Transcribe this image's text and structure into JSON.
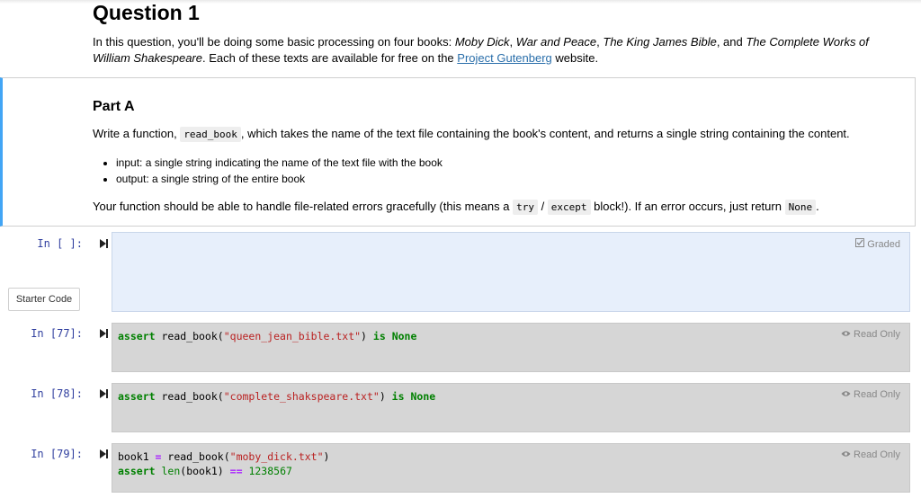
{
  "question": {
    "title": "Question 1",
    "intro": {
      "t1": "In this question, you'll be doing some basic processing on four books: ",
      "book1": "Moby Dick",
      "sep1": ", ",
      "book2": "War and Peace",
      "sep2": ", ",
      "book3": "The King James Bible",
      "sep3": ", and ",
      "book4": "The Complete Works of William Shakespeare",
      "t2": ". Each of these texts are available for free on the ",
      "link": "Project Gutenberg",
      "t3": " website."
    }
  },
  "partA": {
    "title": "Part A",
    "p1_a": "Write a function, ",
    "p1_code": "read_book",
    "p1_b": ", which takes the name of the text file containing the book's content, and returns a single string containing the content.",
    "bullets": [
      "input: a single string indicating the name of the text file with the book",
      "output: a single string of the entire book"
    ],
    "p2_a": "Your function should be able to handle file-related errors gracefully (this means a ",
    "p2_code1": "try",
    "p2_slash": " / ",
    "p2_code2": "except",
    "p2_b": " block!). If an error occurs, just return ",
    "p2_code3": "None",
    "p2_c": "."
  },
  "cells": {
    "c0": {
      "prompt": "In [ ]:",
      "badge": "Graded",
      "starter": "Starter Code"
    },
    "c1": {
      "prompt": "In [77]:",
      "badge": "Read Only",
      "t1": "assert",
      "t2": " read_book(",
      "t3": "\"queen_jean_bible.txt\"",
      "t4": ") ",
      "t5": "is",
      "t6": " ",
      "t7": "None"
    },
    "c2": {
      "prompt": "In [78]:",
      "badge": "Read Only",
      "t1": "assert",
      "t2": " read_book(",
      "t3": "\"complete_shakspeare.txt\"",
      "t4": ") ",
      "t5": "is",
      "t6": " ",
      "t7": "None"
    },
    "c3": {
      "prompt": "In [79]:",
      "badge": "Read Only",
      "l1a": "book1 ",
      "l1b": "=",
      "l1c": " read_book(",
      "l1d": "\"moby_dick.txt\"",
      "l1e": ")",
      "l2a": "assert",
      "l2b": " ",
      "l2c": "len",
      "l2d": "(book1) ",
      "l2e": "==",
      "l2f": " ",
      "l2g": "1238567"
    }
  },
  "icons": {
    "run": "run-cell-icon",
    "check": "checkbox-icon",
    "eye": "eye-icon"
  },
  "colors": {
    "accent": "#42a5f5",
    "link": "#296eaa",
    "prompt": "#303f9f",
    "graded_bg": "#e7effb",
    "readonly_bg": "#d6d6d6"
  }
}
